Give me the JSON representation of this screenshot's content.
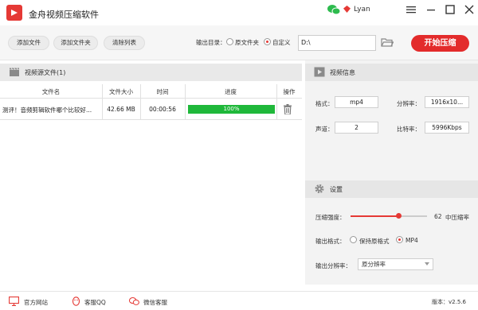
{
  "app": {
    "title": "金舟视频压缩软件",
    "user": "Lyan"
  },
  "toolbar": {
    "add_file": "添加文件",
    "add_folder": "添加文件夹",
    "clear_list": "清除列表",
    "output_label": "输出目录：",
    "option_source": "原文件夹",
    "option_custom": "自定义",
    "selected_option": "自定义",
    "output_path": "D:\\",
    "start_label": "开始压缩"
  },
  "file_list": {
    "title": "视频源文件(1)",
    "columns": [
      "文件名",
      "文件大小",
      "时间",
      "进度",
      "操作"
    ],
    "rows": [
      {
        "name": "测评！音频剪辑软件哪个比较好...",
        "size": "42.66 MB",
        "time": "00:00:56",
        "progress_text": "100%",
        "progress": 1.0
      }
    ]
  },
  "video_info": {
    "title": "视频信息",
    "format_label": "格式：",
    "format_value": "mp4",
    "resolution_label": "分辨率：",
    "resolution_value": "1916x10...",
    "channels_label": "声道：",
    "channels_value": "2",
    "bitrate_label": "比特率：",
    "bitrate_value": "5996Kbps"
  },
  "settings": {
    "title": "设置",
    "strength_label": "压缩强度：",
    "strength_value": "62",
    "strength_fraction": 0.62,
    "strength_level": "中压缩率",
    "format_label": "输出格式：",
    "format_keep": "保持原格式",
    "format_mp4": "MP4",
    "format_selected": "MP4",
    "resolution_label": "输出分辨率：",
    "resolution_value": "原分辨率"
  },
  "footer": {
    "website": "官方网站",
    "qq": "客服QQ",
    "wechat": "微信客服",
    "version": "版本：v2.5.6"
  },
  "colors": {
    "accent": "#e53935",
    "progress": "#1fb83a"
  }
}
